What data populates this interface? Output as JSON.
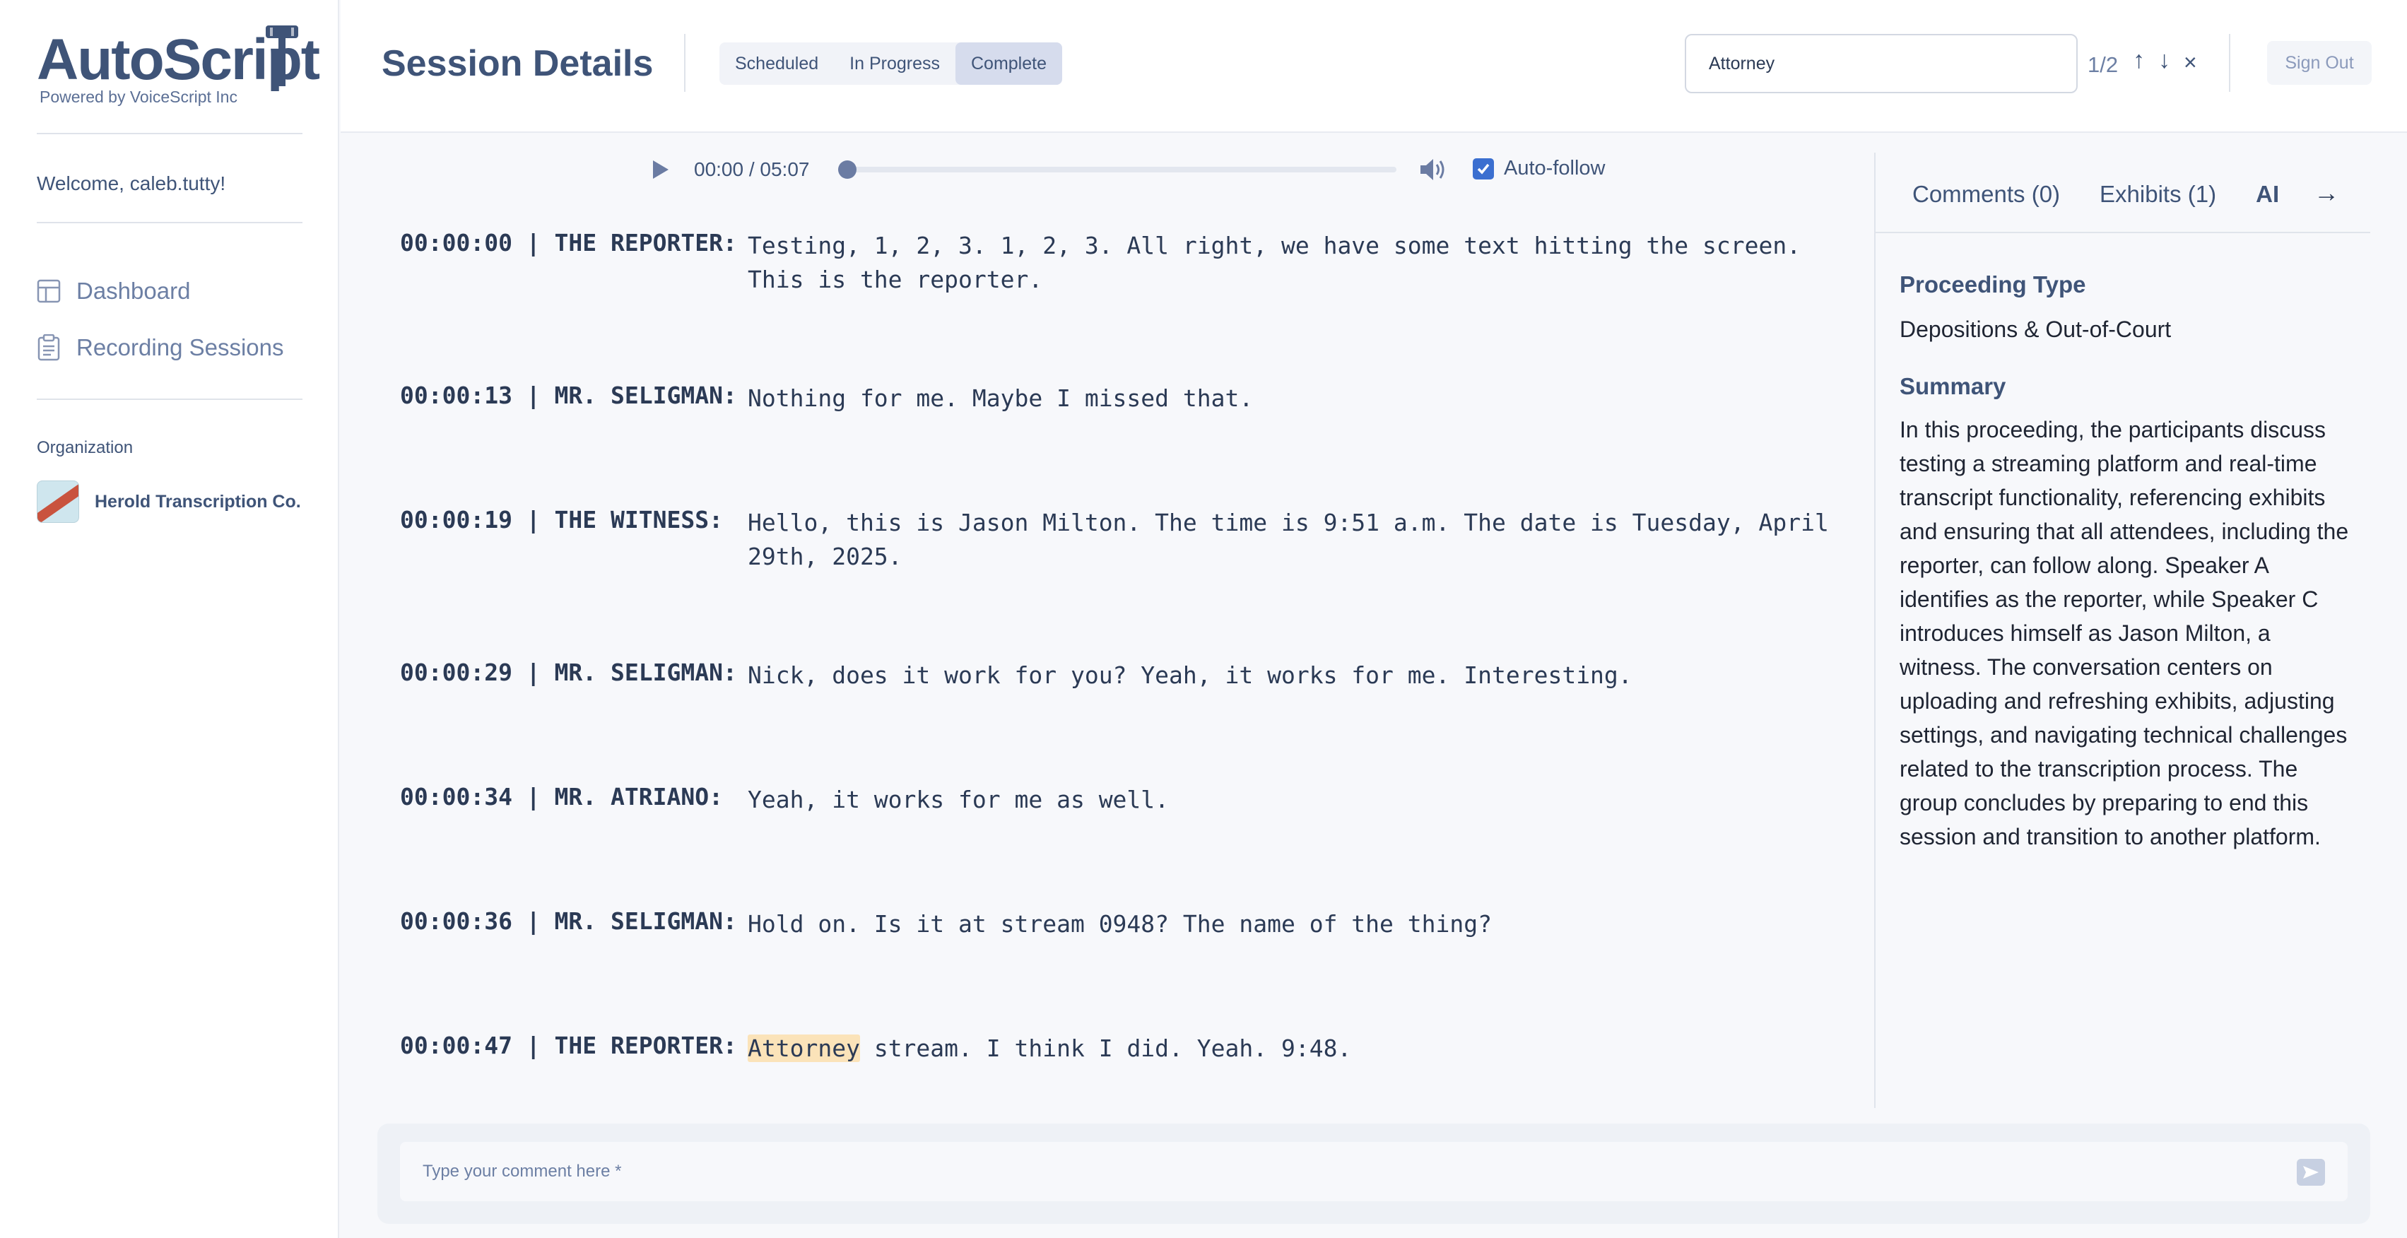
{
  "brand": {
    "name": "AutoScript",
    "tagline": "Powered by VoiceScript Inc"
  },
  "sidebar": {
    "welcome": "Welcome, caleb.tutty!",
    "items": [
      {
        "label": "Dashboard",
        "icon": "dashboard-icon"
      },
      {
        "label": "Recording Sessions",
        "icon": "clipboard-icon"
      }
    ],
    "organization_label": "Organization",
    "organization_name": "Herold Transcription Co."
  },
  "header": {
    "title": "Session Details",
    "status_tabs": [
      {
        "label": "Scheduled",
        "active": false
      },
      {
        "label": "In Progress",
        "active": false
      },
      {
        "label": "Complete",
        "active": true
      }
    ],
    "search": {
      "value": "Attorney",
      "placeholder": ""
    },
    "match_count": "1/2",
    "prev_label": "↑",
    "next_label": "↓",
    "clear_label": "×",
    "sign_out": "Sign Out"
  },
  "player": {
    "time": "00:00 / 05:07",
    "progress": 0,
    "auto_follow_label": "Auto-follow",
    "auto_follow": true
  },
  "transcript": [
    {
      "meta": "00:00:00 | THE REPORTER:",
      "text": "Testing, 1, 2, 3. 1, 2, 3. All right, we have some text hitting the screen. This is the reporter."
    },
    {
      "meta": "00:00:13 | MR. SELIGMAN:",
      "text": "Nothing for me. Maybe I missed that."
    },
    {
      "meta": "00:00:19 | THE WITNESS:",
      "text": "Hello, this is Jason Milton. The time is 9:51 a.m. The date is Tuesday, April 29th, 2025."
    },
    {
      "meta": "00:00:29 | MR. SELIGMAN:",
      "text": "Nick, does it work for you? Yeah, it works for me. Interesting."
    },
    {
      "meta": "00:00:34 | MR. ATRIANO:",
      "text": "Yeah, it works for me as well."
    },
    {
      "meta": "00:00:36 | MR. SELIGMAN:",
      "text": "Hold on. Is it at stream 0948? The name of the thing?"
    },
    {
      "meta": "00:00:47 | THE REPORTER:",
      "highlight": "Attorney",
      "text": " stream. I think I did. Yeah. 9:48."
    }
  ],
  "panel": {
    "tabs": [
      {
        "label": "Comments (0)",
        "active": false
      },
      {
        "label": "Exhibits (1)",
        "active": false
      },
      {
        "label": "AI",
        "active": true
      }
    ],
    "collapse_label": "→",
    "proceeding_type_title": "Proceeding Type",
    "proceeding_type": "Depositions & Out-of-Court",
    "summary_title": "Summary",
    "summary": "In this proceeding, the participants discuss testing a streaming platform and real-time transcript functionality, referencing exhibits and ensuring that all attendees, including the reporter, can follow along. Speaker A identifies as the reporter, while Speaker C introduces himself as Jason Milton, a witness. The conversation centers on uploading and refreshing exhibits, adjusting settings, and navigating technical challenges related to the transcription process. The group concludes by preparing to end this session and transition to another platform."
  },
  "comment": {
    "placeholder": "Type your comment here *"
  },
  "colors": {
    "primary": "#3f5478",
    "highlight": "#fbe3b9",
    "checkbox": "#3b6fd0"
  }
}
